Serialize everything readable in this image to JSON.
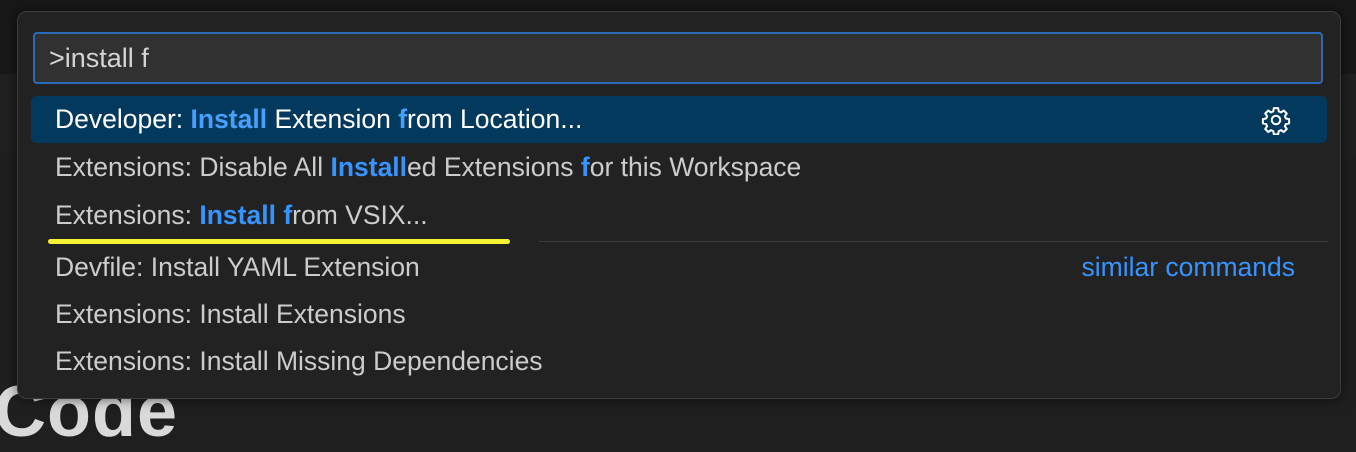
{
  "search": {
    "value": ">install f"
  },
  "background": {
    "text": "Code"
  },
  "rows": [
    {
      "parts": [
        "Developer: ",
        "Install",
        " Extension ",
        "f",
        "rom Location..."
      ],
      "selected": true,
      "has_gear": true,
      "icon": "gear-icon"
    },
    {
      "parts": [
        "Extensions: Disable All ",
        "Install",
        "ed Extensions ",
        "f",
        "or this Workspace"
      ]
    },
    {
      "parts": [
        "Extensions: ",
        "Install",
        " ",
        "f",
        "rom VSIX..."
      ]
    },
    {
      "text": "Devfile: Install YAML Extension",
      "secondary": "similar commands"
    },
    {
      "text": "Extensions: Install Extensions"
    },
    {
      "text": "Extensions: Install Missing Dependencies"
    }
  ],
  "colors": {
    "highlight": "#3794ff",
    "selection": "#04395e",
    "focus_border": "#2a6ab7",
    "annotation_underline": "#f5f233"
  }
}
